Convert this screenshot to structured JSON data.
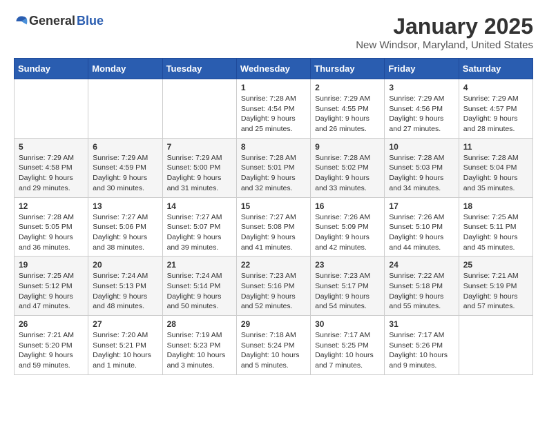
{
  "logo": {
    "general": "General",
    "blue": "Blue"
  },
  "title": "January 2025",
  "subtitle": "New Windsor, Maryland, United States",
  "weekdays": [
    "Sunday",
    "Monday",
    "Tuesday",
    "Wednesday",
    "Thursday",
    "Friday",
    "Saturday"
  ],
  "weeks": [
    [
      {
        "day": "",
        "sunrise": "",
        "sunset": "",
        "daylight": ""
      },
      {
        "day": "",
        "sunrise": "",
        "sunset": "",
        "daylight": ""
      },
      {
        "day": "",
        "sunrise": "",
        "sunset": "",
        "daylight": ""
      },
      {
        "day": "1",
        "sunrise": "Sunrise: 7:28 AM",
        "sunset": "Sunset: 4:54 PM",
        "daylight": "Daylight: 9 hours and 25 minutes."
      },
      {
        "day": "2",
        "sunrise": "Sunrise: 7:29 AM",
        "sunset": "Sunset: 4:55 PM",
        "daylight": "Daylight: 9 hours and 26 minutes."
      },
      {
        "day": "3",
        "sunrise": "Sunrise: 7:29 AM",
        "sunset": "Sunset: 4:56 PM",
        "daylight": "Daylight: 9 hours and 27 minutes."
      },
      {
        "day": "4",
        "sunrise": "Sunrise: 7:29 AM",
        "sunset": "Sunset: 4:57 PM",
        "daylight": "Daylight: 9 hours and 28 minutes."
      }
    ],
    [
      {
        "day": "5",
        "sunrise": "Sunrise: 7:29 AM",
        "sunset": "Sunset: 4:58 PM",
        "daylight": "Daylight: 9 hours and 29 minutes."
      },
      {
        "day": "6",
        "sunrise": "Sunrise: 7:29 AM",
        "sunset": "Sunset: 4:59 PM",
        "daylight": "Daylight: 9 hours and 30 minutes."
      },
      {
        "day": "7",
        "sunrise": "Sunrise: 7:29 AM",
        "sunset": "Sunset: 5:00 PM",
        "daylight": "Daylight: 9 hours and 31 minutes."
      },
      {
        "day": "8",
        "sunrise": "Sunrise: 7:28 AM",
        "sunset": "Sunset: 5:01 PM",
        "daylight": "Daylight: 9 hours and 32 minutes."
      },
      {
        "day": "9",
        "sunrise": "Sunrise: 7:28 AM",
        "sunset": "Sunset: 5:02 PM",
        "daylight": "Daylight: 9 hours and 33 minutes."
      },
      {
        "day": "10",
        "sunrise": "Sunrise: 7:28 AM",
        "sunset": "Sunset: 5:03 PM",
        "daylight": "Daylight: 9 hours and 34 minutes."
      },
      {
        "day": "11",
        "sunrise": "Sunrise: 7:28 AM",
        "sunset": "Sunset: 5:04 PM",
        "daylight": "Daylight: 9 hours and 35 minutes."
      }
    ],
    [
      {
        "day": "12",
        "sunrise": "Sunrise: 7:28 AM",
        "sunset": "Sunset: 5:05 PM",
        "daylight": "Daylight: 9 hours and 36 minutes."
      },
      {
        "day": "13",
        "sunrise": "Sunrise: 7:27 AM",
        "sunset": "Sunset: 5:06 PM",
        "daylight": "Daylight: 9 hours and 38 minutes."
      },
      {
        "day": "14",
        "sunrise": "Sunrise: 7:27 AM",
        "sunset": "Sunset: 5:07 PM",
        "daylight": "Daylight: 9 hours and 39 minutes."
      },
      {
        "day": "15",
        "sunrise": "Sunrise: 7:27 AM",
        "sunset": "Sunset: 5:08 PM",
        "daylight": "Daylight: 9 hours and 41 minutes."
      },
      {
        "day": "16",
        "sunrise": "Sunrise: 7:26 AM",
        "sunset": "Sunset: 5:09 PM",
        "daylight": "Daylight: 9 hours and 42 minutes."
      },
      {
        "day": "17",
        "sunrise": "Sunrise: 7:26 AM",
        "sunset": "Sunset: 5:10 PM",
        "daylight": "Daylight: 9 hours and 44 minutes."
      },
      {
        "day": "18",
        "sunrise": "Sunrise: 7:25 AM",
        "sunset": "Sunset: 5:11 PM",
        "daylight": "Daylight: 9 hours and 45 minutes."
      }
    ],
    [
      {
        "day": "19",
        "sunrise": "Sunrise: 7:25 AM",
        "sunset": "Sunset: 5:12 PM",
        "daylight": "Daylight: 9 hours and 47 minutes."
      },
      {
        "day": "20",
        "sunrise": "Sunrise: 7:24 AM",
        "sunset": "Sunset: 5:13 PM",
        "daylight": "Daylight: 9 hours and 48 minutes."
      },
      {
        "day": "21",
        "sunrise": "Sunrise: 7:24 AM",
        "sunset": "Sunset: 5:14 PM",
        "daylight": "Daylight: 9 hours and 50 minutes."
      },
      {
        "day": "22",
        "sunrise": "Sunrise: 7:23 AM",
        "sunset": "Sunset: 5:16 PM",
        "daylight": "Daylight: 9 hours and 52 minutes."
      },
      {
        "day": "23",
        "sunrise": "Sunrise: 7:23 AM",
        "sunset": "Sunset: 5:17 PM",
        "daylight": "Daylight: 9 hours and 54 minutes."
      },
      {
        "day": "24",
        "sunrise": "Sunrise: 7:22 AM",
        "sunset": "Sunset: 5:18 PM",
        "daylight": "Daylight: 9 hours and 55 minutes."
      },
      {
        "day": "25",
        "sunrise": "Sunrise: 7:21 AM",
        "sunset": "Sunset: 5:19 PM",
        "daylight": "Daylight: 9 hours and 57 minutes."
      }
    ],
    [
      {
        "day": "26",
        "sunrise": "Sunrise: 7:21 AM",
        "sunset": "Sunset: 5:20 PM",
        "daylight": "Daylight: 9 hours and 59 minutes."
      },
      {
        "day": "27",
        "sunrise": "Sunrise: 7:20 AM",
        "sunset": "Sunset: 5:21 PM",
        "daylight": "Daylight: 10 hours and 1 minute."
      },
      {
        "day": "28",
        "sunrise": "Sunrise: 7:19 AM",
        "sunset": "Sunset: 5:23 PM",
        "daylight": "Daylight: 10 hours and 3 minutes."
      },
      {
        "day": "29",
        "sunrise": "Sunrise: 7:18 AM",
        "sunset": "Sunset: 5:24 PM",
        "daylight": "Daylight: 10 hours and 5 minutes."
      },
      {
        "day": "30",
        "sunrise": "Sunrise: 7:17 AM",
        "sunset": "Sunset: 5:25 PM",
        "daylight": "Daylight: 10 hours and 7 minutes."
      },
      {
        "day": "31",
        "sunrise": "Sunrise: 7:17 AM",
        "sunset": "Sunset: 5:26 PM",
        "daylight": "Daylight: 10 hours and 9 minutes."
      },
      {
        "day": "",
        "sunrise": "",
        "sunset": "",
        "daylight": ""
      }
    ]
  ]
}
